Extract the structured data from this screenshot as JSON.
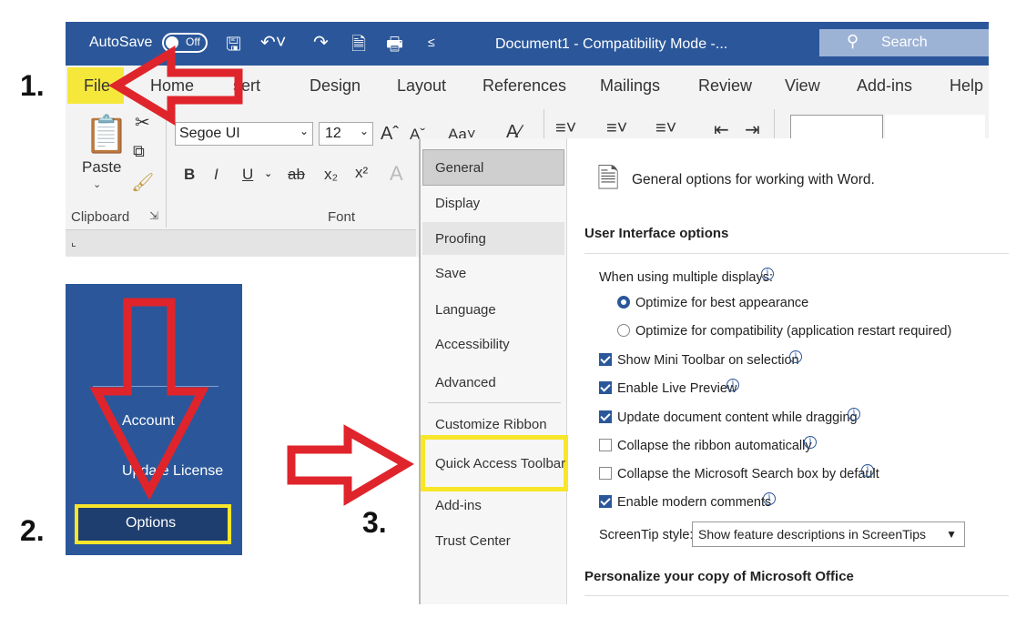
{
  "titlebar": {
    "autosave_label": "AutoSave",
    "autosave_state": "Off",
    "document_title": "Document1  -  Compatibility Mode  -...",
    "search_label": "Search"
  },
  "ribbon_tabs": [
    "File",
    "Home",
    "Insert",
    "Design",
    "Layout",
    "References",
    "Mailings",
    "Review",
    "View",
    "Add-ins",
    "Help"
  ],
  "ribbon_tab_insert_visible": "sert",
  "clipboard": {
    "paste_label": "Paste",
    "group_label": "Clipboard"
  },
  "font": {
    "font_name": "Segoe UI",
    "font_size": "12",
    "group_label": "Font",
    "case_label": "Aa"
  },
  "backstage": {
    "account": "Account",
    "update_license": "Update License",
    "options": "Options"
  },
  "dialog": {
    "nav": [
      "General",
      "Display",
      "Proofing",
      "Save",
      "Language",
      "Accessibility",
      "Advanced",
      "Customize Ribbon",
      "Quick Access Toolbar",
      "Add-ins",
      "Trust Center"
    ],
    "header_text": "General options for working with Word.",
    "section_ui": "User Interface options",
    "multi_display_label": "When using multiple displays:",
    "radio_best": "Optimize for best appearance",
    "radio_compat": "Optimize for compatibility (application restart required)",
    "checkboxes": [
      {
        "label": "Show Mini Toolbar on selection",
        "checked": true
      },
      {
        "label": "Enable Live Preview",
        "checked": true
      },
      {
        "label": "Update document content while dragging",
        "checked": true
      },
      {
        "label": "Collapse the ribbon automatically",
        "checked": false
      },
      {
        "label": "Collapse the Microsoft Search box by default",
        "checked": false
      },
      {
        "label": "Enable modern comments",
        "checked": true
      }
    ],
    "screentip_label": "ScreenTip style:",
    "screentip_value": "Show feature descriptions in ScreenTips",
    "section_personalize": "Personalize your copy of Microsoft Office"
  },
  "steps": [
    "1.",
    "2.",
    "3."
  ],
  "colors": {
    "word_blue": "#2b579a",
    "highlight_yellow": "#f8e629",
    "arrow_red": "#e0242b"
  }
}
